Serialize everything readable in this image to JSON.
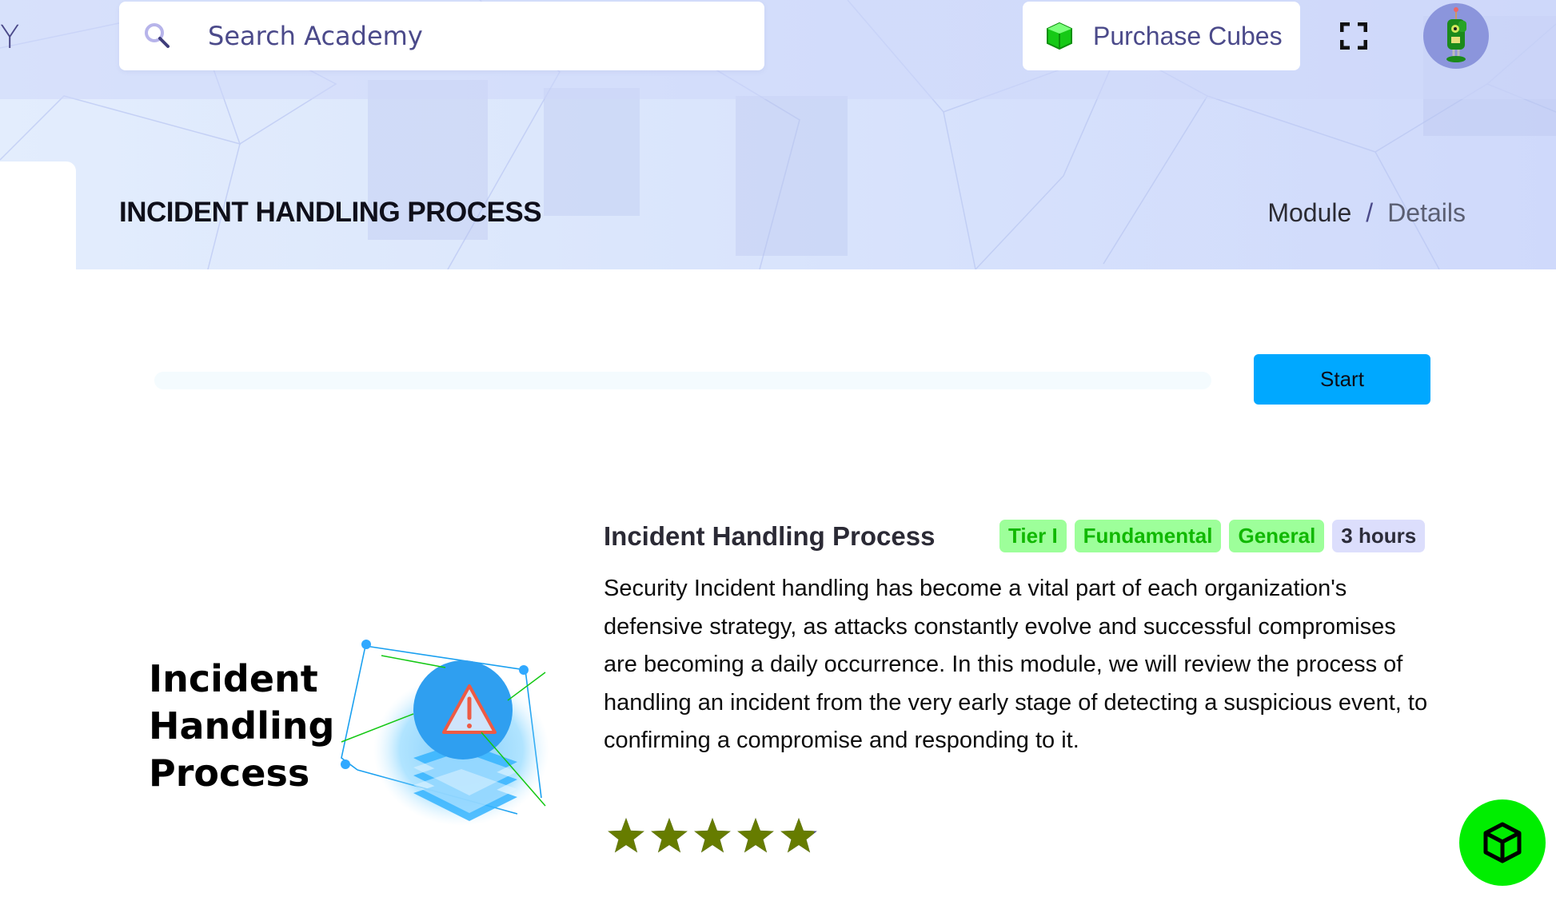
{
  "header": {
    "brand_fragment": "Y",
    "search": {
      "placeholder": "Search Academy",
      "value": ""
    },
    "purchase_label": "Purchase Cubes"
  },
  "page": {
    "title": "INCIDENT HANDLING PROCESS",
    "breadcrumb": [
      {
        "label": "Module"
      },
      {
        "label": "/"
      },
      {
        "label": "Details"
      }
    ]
  },
  "progress": {
    "percent": 0,
    "start_label": "Start"
  },
  "module": {
    "image_text": [
      "Incident",
      "Handling",
      "Process"
    ],
    "name": "Incident Handling Process",
    "tags": [
      {
        "label": "Tier I",
        "style": "green"
      },
      {
        "label": "Fundamental",
        "style": "green"
      },
      {
        "label": "General",
        "style": "green"
      },
      {
        "label": "3 hours",
        "style": "gray"
      }
    ],
    "description": "Security Incident handling has become a vital part of each organization's defensive strategy, as attacks constantly evolve and successful compromises are becoming a daily occurrence. In this module, we will review the process of handling an incident from the very early stage of detecting a suspicious event, to confirming a compromise and responding to it.",
    "rating": {
      "value": 4.9,
      "max": 5
    }
  },
  "colors": {
    "accent": "#00a8ff",
    "tag_green_bg": "#9dff9a",
    "tag_green_text": "#10b800",
    "tag_gray_bg": "#dcdefc",
    "star_fill": "#667c00",
    "star_empty": "#4b4a8a",
    "fab_bg": "#00ee00"
  }
}
